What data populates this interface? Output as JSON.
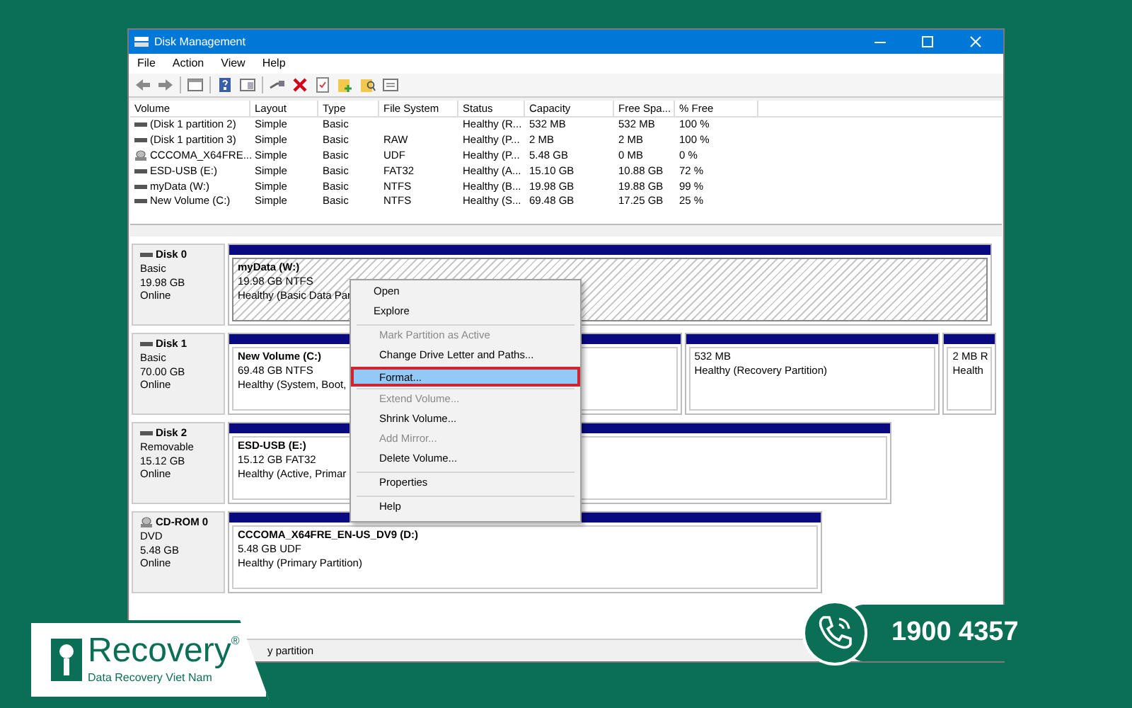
{
  "window": {
    "title": "Disk Management"
  },
  "menu_bar": [
    "File",
    "Action",
    "View",
    "Help"
  ],
  "volume_table": {
    "columns": [
      "Volume",
      "Layout",
      "Type",
      "File System",
      "Status",
      "Capacity",
      "Free Spa...",
      "% Free"
    ],
    "rows": [
      {
        "kind": "disk",
        "cells": [
          "(Disk 1 partition 2)",
          "Simple",
          "Basic",
          "",
          "Healthy (R...",
          "532 MB",
          "532 MB",
          "100 %"
        ]
      },
      {
        "kind": "disk",
        "cells": [
          "(Disk 1 partition 3)",
          "Simple",
          "Basic",
          "RAW",
          "Healthy (P...",
          "2 MB",
          "2 MB",
          "100 %"
        ]
      },
      {
        "kind": "cd",
        "cells": [
          "CCCOMA_X64FRE...",
          "Simple",
          "Basic",
          "UDF",
          "Healthy (P...",
          "5.48 GB",
          "0 MB",
          "0 %"
        ]
      },
      {
        "kind": "disk",
        "cells": [
          "ESD-USB (E:)",
          "Simple",
          "Basic",
          "FAT32",
          "Healthy (A...",
          "15.10 GB",
          "10.88 GB",
          "72 %"
        ]
      },
      {
        "kind": "disk",
        "cells": [
          "myData (W:)",
          "Simple",
          "Basic",
          "NTFS",
          "Healthy (B...",
          "19.98 GB",
          "19.88 GB",
          "99 %"
        ]
      },
      {
        "kind": "disk",
        "cells": [
          "New Volume (C:)",
          "Simple",
          "Basic",
          "NTFS",
          "Healthy (S...",
          "69.48 GB",
          "17.25 GB",
          "25 %"
        ]
      }
    ]
  },
  "disks": [
    {
      "kind": "disk",
      "name": "Disk 0",
      "lines": [
        "Basic",
        "19.98 GB",
        "Online"
      ],
      "partitions": [
        {
          "name": "myData  (W:)",
          "lines": [
            "19.98 GB NTFS",
            "Healthy (Basic Data Par"
          ],
          "selected": true
        }
      ]
    },
    {
      "kind": "disk",
      "name": "Disk 1",
      "lines": [
        "Basic",
        "70.00 GB",
        "Online"
      ],
      "partitions": [
        {
          "name": "New Volume  (C:)",
          "lines": [
            "69.48 GB NTFS",
            "Healthy (System, Boot,"
          ],
          "selected": false
        },
        {
          "lines": [
            "532 MB",
            "Healthy (Recovery Partition)"
          ],
          "selected": false
        },
        {
          "lines": [
            "2 MB R",
            "Health"
          ],
          "selected": false
        }
      ]
    },
    {
      "kind": "disk",
      "name": "Disk 2",
      "lines": [
        "Removable",
        "15.12 GB",
        "Online"
      ],
      "partitions": [
        {
          "name": "ESD-USB  (E:)",
          "lines": [
            "15.12 GB FAT32",
            "Healthy (Active, Primar"
          ],
          "selected": false
        }
      ]
    },
    {
      "kind": "cd",
      "name": "CD-ROM 0",
      "lines": [
        "DVD",
        "5.48 GB",
        "Online"
      ],
      "partitions": [
        {
          "name": "CCCOMA_X64FRE_EN-US_DV9  (D:)",
          "lines": [
            "5.48 GB UDF",
            "Healthy (Primary Partition)"
          ],
          "selected": false
        }
      ]
    }
  ],
  "context_menu": [
    [
      {
        "label": "Open",
        "disabled": false,
        "selected": false
      },
      {
        "label": "Explore",
        "disabled": false,
        "selected": false
      }
    ],
    [
      {
        "label": "Mark Partition as Active",
        "disabled": true,
        "selected": false
      },
      {
        "label": "Change Drive Letter and Paths...",
        "disabled": false,
        "selected": false
      },
      {
        "label": "Format...",
        "disabled": false,
        "selected": true
      }
    ],
    [
      {
        "label": "Extend Volume...",
        "disabled": true,
        "selected": false
      },
      {
        "label": "Shrink Volume...",
        "disabled": false,
        "selected": false
      },
      {
        "label": "Add Mirror...",
        "disabled": true,
        "selected": false
      },
      {
        "label": "Delete Volume...",
        "disabled": false,
        "selected": false
      }
    ],
    [
      {
        "label": "Properties",
        "disabled": false,
        "selected": false
      }
    ],
    [
      {
        "label": "Help",
        "disabled": false,
        "selected": false
      }
    ]
  ],
  "status_bar": {
    "legend": "y partition"
  },
  "brand": {
    "name": "Recovery",
    "mark": "®",
    "tagline": "Data Recovery Viet Nam"
  },
  "hotline": {
    "number": "1900 4357"
  }
}
